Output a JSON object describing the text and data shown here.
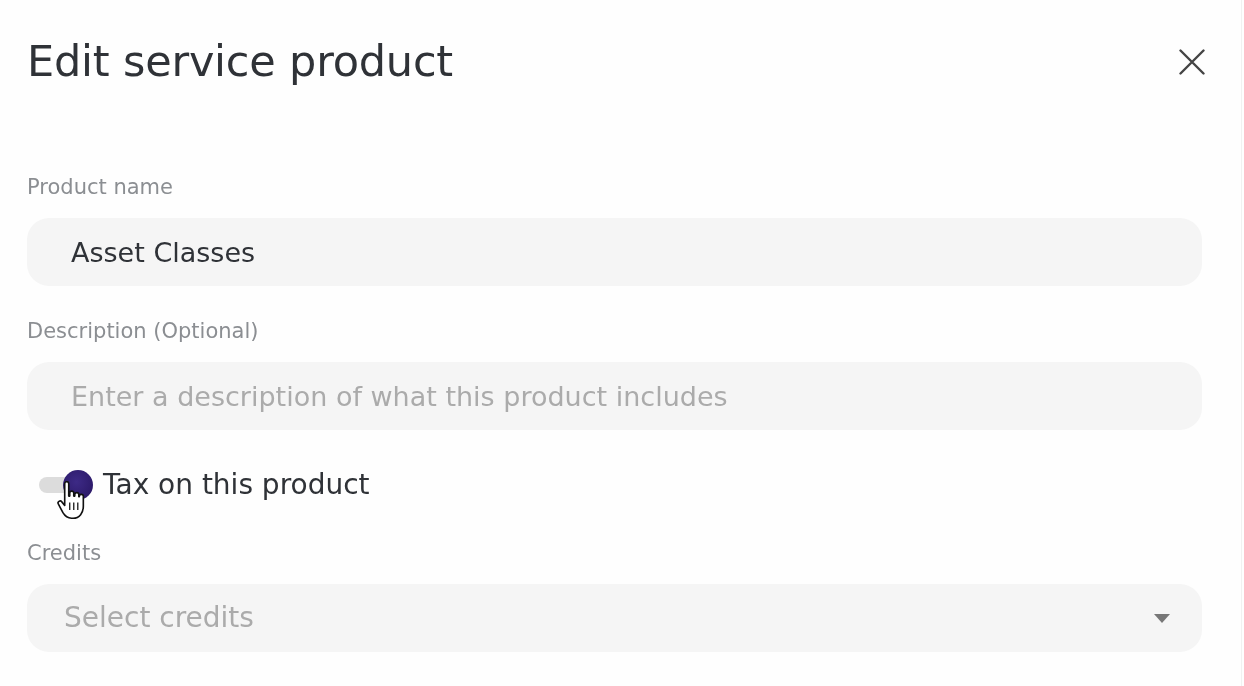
{
  "dialog": {
    "title": "Edit service product"
  },
  "fields": [
    {
      "kind": "text",
      "label": "Product name",
      "value": "Asset Classes"
    },
    {
      "kind": "text",
      "label": "Description (Optional)",
      "placeholder": "Enter a description of what this product includes"
    },
    {
      "kind": "switch",
      "label": "Tax on this product",
      "on": true
    },
    {
      "kind": "select",
      "label": "Credits",
      "placeholder": "Select credits"
    }
  ]
}
